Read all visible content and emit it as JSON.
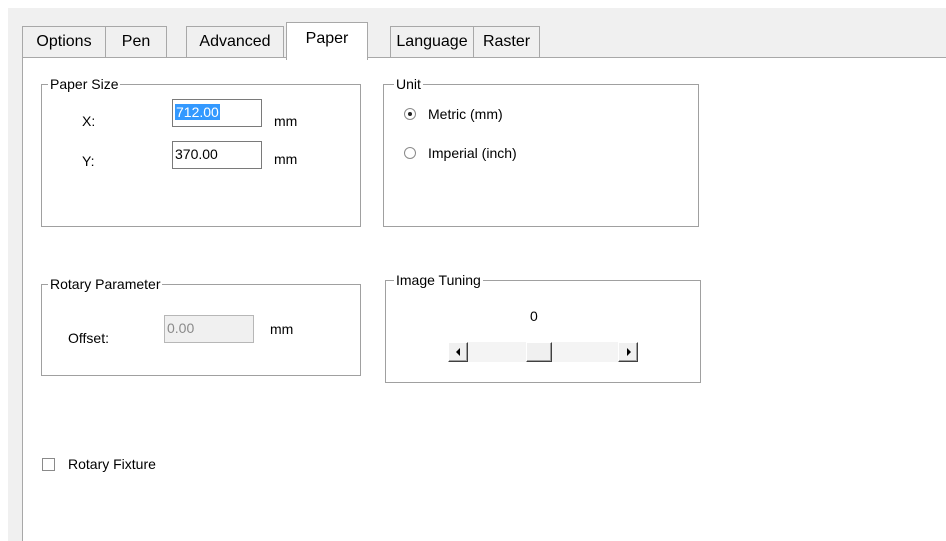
{
  "tabs": [
    {
      "label": "Options",
      "active": false
    },
    {
      "label": "Pen",
      "active": false
    },
    {
      "label": "Advanced",
      "active": false
    },
    {
      "label": "Paper",
      "active": true
    },
    {
      "label": "Language",
      "active": false
    },
    {
      "label": "Raster",
      "active": false
    }
  ],
  "paper_size": {
    "title": "Paper Size",
    "x_label": "X:",
    "x_value": "712.00",
    "x_unit": "mm",
    "y_label": "Y:",
    "y_value": "370.00",
    "y_unit": "mm"
  },
  "unit": {
    "title": "Unit",
    "options": [
      {
        "label": "Metric (mm)",
        "selected": true
      },
      {
        "label": "Imperial (inch)",
        "selected": false
      }
    ]
  },
  "rotary_parameter": {
    "title": "Rotary Parameter",
    "offset_label": "Offset:",
    "offset_value": "0.00",
    "offset_unit": "mm"
  },
  "image_tuning": {
    "title": "Image Tuning",
    "value_label": "0",
    "slider_value": 0,
    "slider_min": -10,
    "slider_max": 10
  },
  "rotary_fixture": {
    "label": "Rotary Fixture",
    "checked": false
  }
}
